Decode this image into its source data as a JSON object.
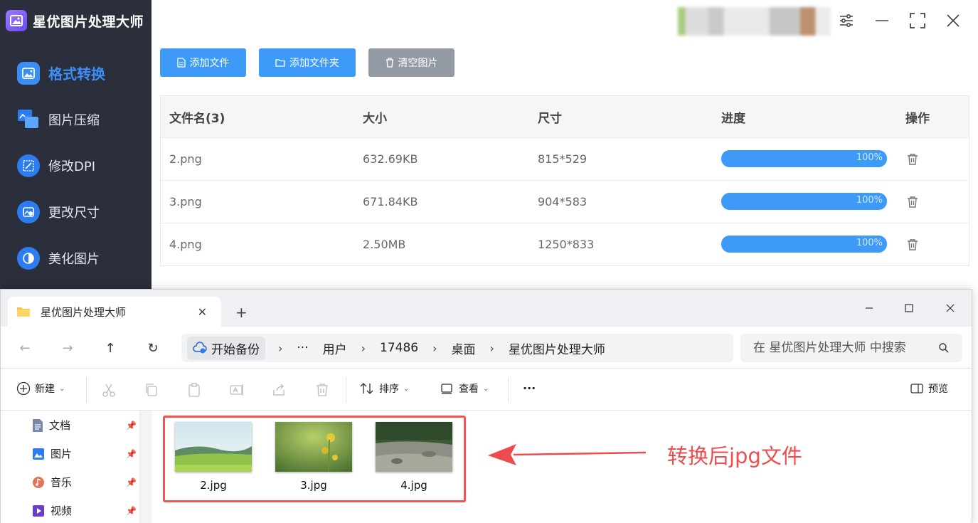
{
  "app": {
    "title": "星优图片处理大师",
    "accent_color": "#3d9bf7",
    "sidebar_bg": "#2b2e3b"
  },
  "sidebar": {
    "items": [
      {
        "label": "格式转换",
        "icon": "image-convert-icon",
        "active": true
      },
      {
        "label": "图片压缩",
        "icon": "compress-icon",
        "active": false
      },
      {
        "label": "修改DPI",
        "icon": "dpi-icon",
        "active": false
      },
      {
        "label": "更改尺寸",
        "icon": "resize-icon",
        "active": false
      },
      {
        "label": "美化图片",
        "icon": "beautify-icon",
        "active": false
      }
    ]
  },
  "toolbar": {
    "add_file": "添加文件",
    "add_folder": "添加文件夹",
    "clear_images": "清空图片"
  },
  "table": {
    "headers": {
      "name": "文件名(3)",
      "size": "大小",
      "dimensions": "尺寸",
      "progress": "进度",
      "action": "操作"
    },
    "rows": [
      {
        "name": "2.png",
        "size": "632.69KB",
        "dimensions": "815*529",
        "progress_text": "100%",
        "progress": 100
      },
      {
        "name": "3.png",
        "size": "671.84KB",
        "dimensions": "904*583",
        "progress_text": "100%",
        "progress": 100
      },
      {
        "name": "4.png",
        "size": "2.50MB",
        "dimensions": "1250*833",
        "progress_text": "100%",
        "progress": 100
      }
    ]
  },
  "explorer": {
    "tab_title": "星优图片处理大师",
    "breadcrumb": {
      "backup": "开始备份",
      "ellipsis": "···",
      "items": [
        "用户",
        "17486",
        "桌面",
        "星优图片处理大师"
      ]
    },
    "search_placeholder": "在 星优图片处理大师 中搜索",
    "commands": {
      "new": "新建",
      "sort": "排序",
      "view": "查看",
      "more": "···",
      "preview": "预览"
    },
    "sidebar": [
      {
        "label": "文档",
        "icon": "document-icon"
      },
      {
        "label": "图片",
        "icon": "pictures-icon"
      },
      {
        "label": "音乐",
        "icon": "music-icon"
      },
      {
        "label": "视频",
        "icon": "video-icon"
      }
    ],
    "files": [
      {
        "label": "2.jpg"
      },
      {
        "label": "3.jpg"
      },
      {
        "label": "4.jpg"
      }
    ]
  },
  "annotation": {
    "text": "转换后jpg文件",
    "color": "#ef4d4d"
  }
}
